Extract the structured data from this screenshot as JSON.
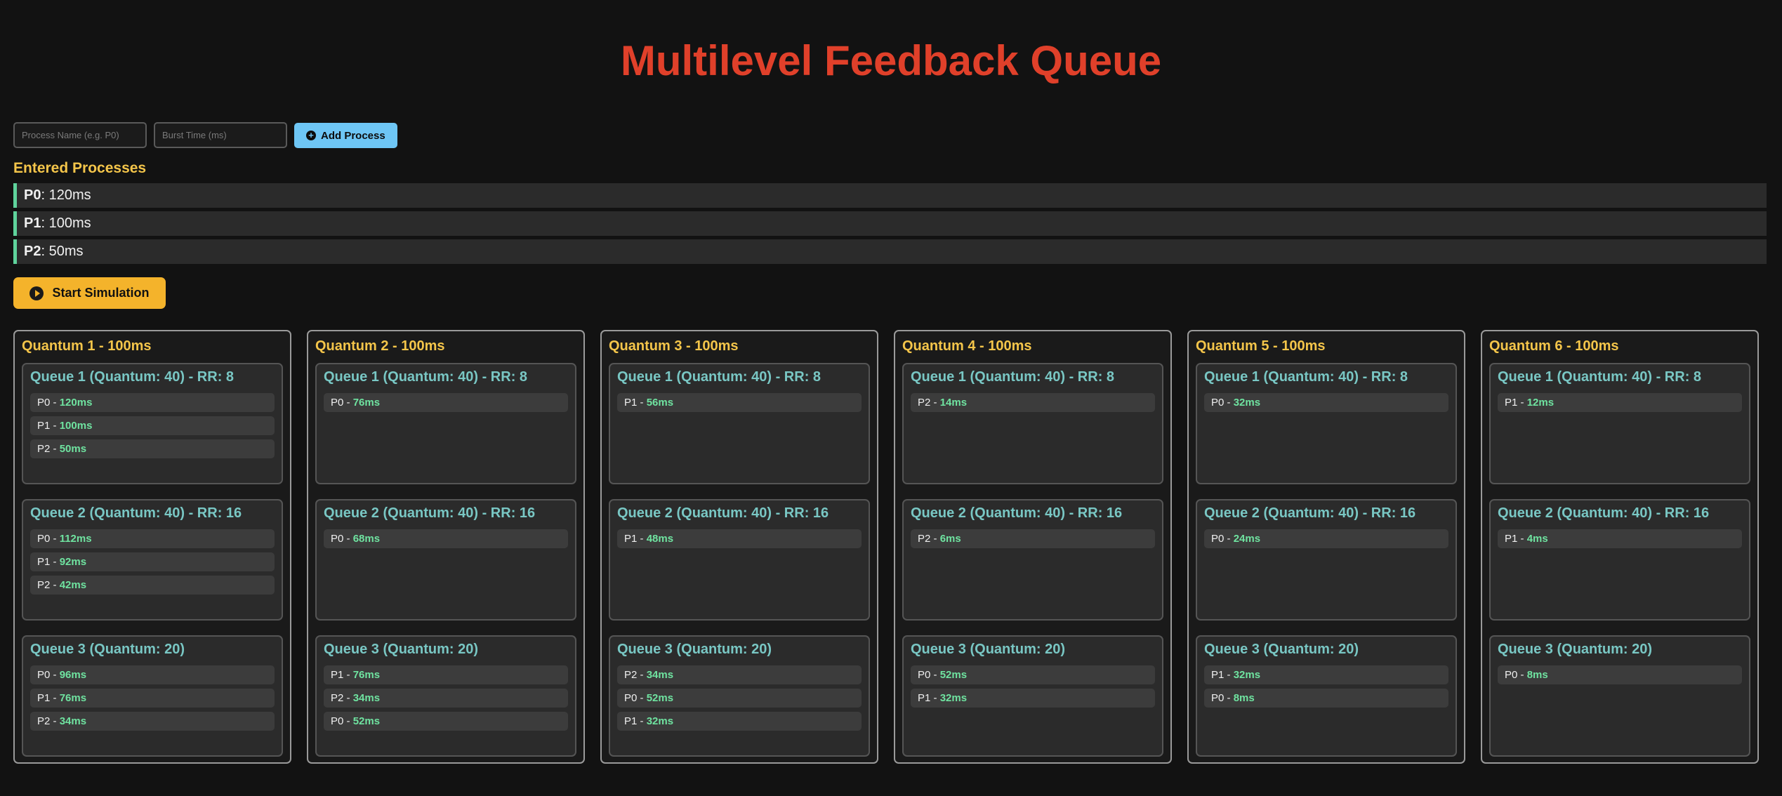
{
  "title": "Multilevel Feedback Queue",
  "form": {
    "name_placeholder": "Process Name (e.g. P0)",
    "burst_placeholder": "Burst Time (ms)",
    "add_label": "Add Process"
  },
  "entered": {
    "heading": "Entered Processes",
    "items": [
      {
        "name": "P0",
        "time": ": 120ms"
      },
      {
        "name": "P1",
        "time": ": 100ms"
      },
      {
        "name": "P2",
        "time": ": 50ms"
      }
    ]
  },
  "start_label": "Start Simulation",
  "quanta": [
    {
      "title": "Quantum 1 - 100ms",
      "queues": [
        {
          "title": "Queue 1 (Quantum: 40) - RR: 8",
          "items": [
            {
              "p": "P0",
              "t": "120ms"
            },
            {
              "p": "P1",
              "t": "100ms"
            },
            {
              "p": "P2",
              "t": "50ms"
            }
          ]
        },
        {
          "title": "Queue 2 (Quantum: 40) - RR: 16",
          "items": [
            {
              "p": "P0",
              "t": "112ms"
            },
            {
              "p": "P1",
              "t": "92ms"
            },
            {
              "p": "P2",
              "t": "42ms"
            }
          ]
        },
        {
          "title": "Queue 3 (Quantum: 20)",
          "items": [
            {
              "p": "P0",
              "t": "96ms"
            },
            {
              "p": "P1",
              "t": "76ms"
            },
            {
              "p": "P2",
              "t": "34ms"
            }
          ]
        }
      ]
    },
    {
      "title": "Quantum 2 - 100ms",
      "queues": [
        {
          "title": "Queue 1 (Quantum: 40) - RR: 8",
          "items": [
            {
              "p": "P0",
              "t": "76ms"
            }
          ]
        },
        {
          "title": "Queue 2 (Quantum: 40) - RR: 16",
          "items": [
            {
              "p": "P0",
              "t": "68ms"
            }
          ]
        },
        {
          "title": "Queue 3 (Quantum: 20)",
          "items": [
            {
              "p": "P1",
              "t": "76ms"
            },
            {
              "p": "P2",
              "t": "34ms"
            },
            {
              "p": "P0",
              "t": "52ms"
            }
          ]
        }
      ]
    },
    {
      "title": "Quantum 3 - 100ms",
      "queues": [
        {
          "title": "Queue 1 (Quantum: 40) - RR: 8",
          "items": [
            {
              "p": "P1",
              "t": "56ms"
            }
          ]
        },
        {
          "title": "Queue 2 (Quantum: 40) - RR: 16",
          "items": [
            {
              "p": "P1",
              "t": "48ms"
            }
          ]
        },
        {
          "title": "Queue 3 (Quantum: 20)",
          "items": [
            {
              "p": "P2",
              "t": "34ms"
            },
            {
              "p": "P0",
              "t": "52ms"
            },
            {
              "p": "P1",
              "t": "32ms"
            }
          ]
        }
      ]
    },
    {
      "title": "Quantum 4 - 100ms",
      "queues": [
        {
          "title": "Queue 1 (Quantum: 40) - RR: 8",
          "items": [
            {
              "p": "P2",
              "t": "14ms"
            }
          ]
        },
        {
          "title": "Queue 2 (Quantum: 40) - RR: 16",
          "items": [
            {
              "p": "P2",
              "t": "6ms"
            }
          ]
        },
        {
          "title": "Queue 3 (Quantum: 20)",
          "items": [
            {
              "p": "P0",
              "t": "52ms"
            },
            {
              "p": "P1",
              "t": "32ms"
            }
          ]
        }
      ]
    },
    {
      "title": "Quantum 5 - 100ms",
      "queues": [
        {
          "title": "Queue 1 (Quantum: 40) - RR: 8",
          "items": [
            {
              "p": "P0",
              "t": "32ms"
            }
          ]
        },
        {
          "title": "Queue 2 (Quantum: 40) - RR: 16",
          "items": [
            {
              "p": "P0",
              "t": "24ms"
            }
          ]
        },
        {
          "title": "Queue 3 (Quantum: 20)",
          "items": [
            {
              "p": "P1",
              "t": "32ms"
            },
            {
              "p": "P0",
              "t": "8ms"
            }
          ]
        }
      ]
    },
    {
      "title": "Quantum 6 - 100ms",
      "queues": [
        {
          "title": "Queue 1 (Quantum: 40) - RR: 8",
          "items": [
            {
              "p": "P1",
              "t": "12ms"
            }
          ]
        },
        {
          "title": "Queue 2 (Quantum: 40) - RR: 16",
          "items": [
            {
              "p": "P1",
              "t": "4ms"
            }
          ]
        },
        {
          "title": "Queue 3 (Quantum: 20)",
          "items": [
            {
              "p": "P0",
              "t": "8ms"
            }
          ]
        }
      ]
    }
  ],
  "colors": {
    "background": "#121212",
    "title": "#e0402a",
    "accent_yellow": "#f4c54a",
    "queue_title": "#79c7c4",
    "time_green": "#6fe3a0",
    "add_button": "#6ec6f5",
    "start_button": "#f4b32b"
  },
  "icons": {
    "add": "plus-circle-icon",
    "start": "play-circle-icon"
  }
}
